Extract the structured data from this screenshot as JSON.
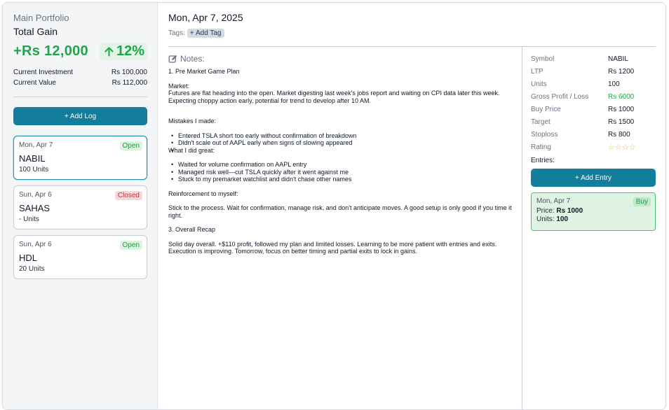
{
  "sidebar": {
    "portfolio_name": "Main Portfolio",
    "total_gain_label": "Total Gain",
    "gain_amount": "+Rs 12,000",
    "gain_percent": "12%",
    "current_investment_label": "Current Investment",
    "current_investment_value": "Rs 100,000",
    "current_value_label": "Current Value",
    "current_value_value": "Rs 112,000",
    "add_log_label": "+ Add Log",
    "logs": [
      {
        "date": "Mon, Apr 7",
        "status": "Open",
        "symbol": "NABIL",
        "units": "100 Units"
      },
      {
        "date": "Sun, Apr 6",
        "status": "Closed",
        "symbol": "SAHAS",
        "units": "- Units"
      },
      {
        "date": "Sun, Apr 6",
        "status": "Open",
        "symbol": "HDL",
        "units": "20 Units"
      }
    ]
  },
  "main": {
    "date_title": "Mon, Apr 7, 2025",
    "tags_label": "Tags:",
    "add_tag_label": "+ Add Tag",
    "notes_label": "Notes:",
    "notes": {
      "heading1": "1. Pre Market Game Plan",
      "market_label": "Market:",
      "market_text": "Futures are flat heading into the open. Market digesting last week's jobs report and waiting on CPI data later this week. Expecting choppy action early, potential for trend to develop after 10 AM.",
      "mistakes_label": "Mistakes I made:",
      "mistakes": [
        "Entered TSLA short too early without confirmation of breakdown",
        "Didn't scale out of AAPL early when signs of slowing appeared",
        ""
      ],
      "great_label": "What I did great:",
      "great": [
        "Waited for volume confirmation on AAPL entry",
        "Managed risk well—cut TSLA quickly after it went against me",
        "Stuck to my premarket watchlist and didn't chase other names"
      ],
      "reinforcement_label": "Reinforcement to myself:",
      "reinforcement_text": "Stick to the process. Wait for confirmation, manage risk, and don't anticipate moves. A good setup is only good if you time it right.",
      "heading3": "3. Overall Recap",
      "recap_text": "Solid day overall. +$110 profit, followed my plan and limited losses. Learning to be more patient with entries and exits. Execution is improving. Tomorrow, focus on better timing and partial exits to lock in gains."
    },
    "details": [
      {
        "label": "Symbol",
        "value": "NABIL"
      },
      {
        "label": "LTP",
        "value": "Rs 1200"
      },
      {
        "label": "Units",
        "value": "100"
      },
      {
        "label": "Gross Profit / Loss",
        "value": "Rs 6000"
      },
      {
        "label": "Buy Price",
        "value": "Rs 1000"
      },
      {
        "label": "Target",
        "value": "Rs 1500"
      },
      {
        "label": "Stoploss",
        "value": "Rs 800"
      },
      {
        "label": "Rating",
        "value": "☆☆☆☆"
      }
    ],
    "entries_label": "Entries:",
    "add_entry_label": "+ Add Entry",
    "entry": {
      "date": "Mon, Apr 7",
      "type": "Buy",
      "price_label": "Price:",
      "price_value": "Rs 1000",
      "units_label": "Units:",
      "units_value": "100"
    }
  },
  "colors": {
    "accent": "#137e9b",
    "gain_green": "#1fa64a",
    "closed_red": "#c1343c"
  }
}
